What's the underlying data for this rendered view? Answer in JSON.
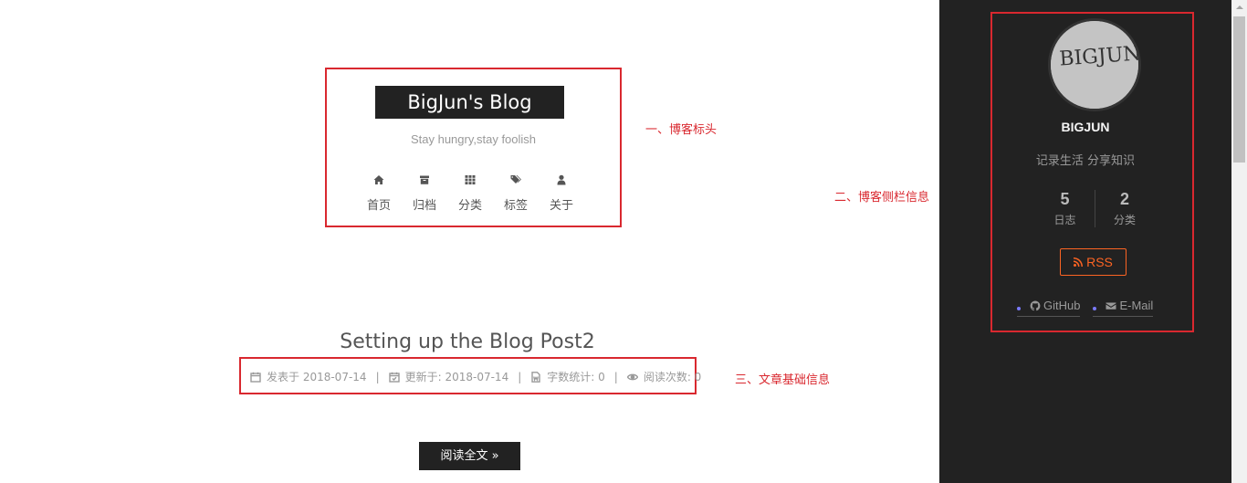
{
  "header": {
    "brand": "BigJun's Blog",
    "subtitle": "Stay hungry,stay foolish",
    "menu": [
      {
        "label": "首页",
        "icon": "home-icon"
      },
      {
        "label": "归档",
        "icon": "archive-icon"
      },
      {
        "label": "分类",
        "icon": "th-icon"
      },
      {
        "label": "标签",
        "icon": "tags-icon"
      },
      {
        "label": "关于",
        "icon": "user-icon"
      }
    ]
  },
  "annotations": {
    "a1": "一、博客标头",
    "a2": "二、博客侧栏信息",
    "a3": "三、文章基础信息"
  },
  "post": {
    "title": "Setting up the Blog Post2",
    "meta": {
      "posted": "发表于 2018-07-14",
      "updated": "更新于: 2018-07-14",
      "wordcount": "字数统计: 0",
      "views": "阅读次数: 0",
      "separator": "|"
    },
    "read_more": "阅读全文 »"
  },
  "sidebar": {
    "avatar_text": "BIGJUN",
    "author": "BIGJUN",
    "description": "记录生活 分享知识",
    "stats": [
      {
        "count": "5",
        "label": "日志"
      },
      {
        "count": "2",
        "label": "分类"
      }
    ],
    "rss": "RSS",
    "links": [
      {
        "label": "GitHub",
        "icon": "github-icon"
      },
      {
        "label": "E-Mail",
        "icon": "envelope-icon"
      }
    ]
  },
  "colors": {
    "annotation": "#d9282f",
    "sidebar_bg": "#222222",
    "rss": "#fc6423"
  }
}
